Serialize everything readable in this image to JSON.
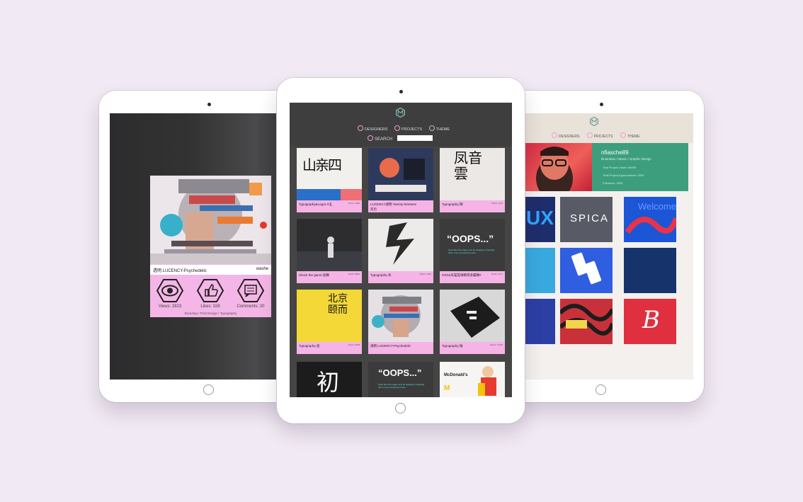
{
  "center": {
    "nav": {
      "items": [
        "DESIGNERS",
        "PROJECTS",
        "THEME"
      ],
      "search_label": "SEARCH"
    },
    "cards": [
      {
        "title": "Typography&Logos #五",
        "views": "Views: 1848",
        "art_text": "山亲四"
      },
      {
        "title": "LUCENCY透明 Twenty Nineteen",
        "title2": "年历",
        "views": "",
        "art_text": ""
      },
      {
        "title": "Typography-御",
        "views": "Views: 1211",
        "art_text": "凤音雲"
      },
      {
        "title": "Shock the game-劲舞",
        "views": "Views: 8662",
        "art_text": ""
      },
      {
        "title": "Typography-冰",
        "views": "Views: 1034",
        "art_text": ""
      },
      {
        "title": "#2018天猫篮球精英争霸赛#",
        "views": "Views: 4271",
        "art_text": "“OOPS...”"
      },
      {
        "title": "Typography-佰",
        "views": "Views: 6628",
        "art_text": "北京颐而"
      },
      {
        "title": "透明 LUCENCY-Psychedelic",
        "views": "",
        "art_text": ""
      },
      {
        "title": "Typography-陆",
        "views": "Views: 17346",
        "art_text": ""
      },
      {
        "title": "",
        "views": "",
        "art_text": "初"
      },
      {
        "title": "",
        "views": "",
        "art_text": "“OOPS...”"
      },
      {
        "title": "",
        "views": "",
        "art_text": "McDonald's"
      }
    ],
    "oops_sub": "looks like this image can't be displayed, hopefully this is only a temporary issue."
  },
  "left": {
    "title": "透明 LUCENCY-Psychedelic",
    "user": "washe",
    "stats": [
      {
        "label": "Views: 2823",
        "icon": "eye-icon"
      },
      {
        "label": "Likes: 328",
        "icon": "thumbs-up-icon"
      },
      {
        "label": "Comments: 20",
        "icon": "comment-icon"
      }
    ],
    "tags": "Branding / Print Design / Typography"
  },
  "right": {
    "nav": {
      "items": [
        "DESIGNERS",
        "PROJECTS",
        "THEME"
      ]
    },
    "profile": {
      "name": "nfiasche89",
      "role": "Illustration / Music / Graphic Design",
      "meta": [
        "Total Project Views: 99999",
        "Total Project Appreciations: 3000",
        "Followers: 3000"
      ]
    },
    "thumbs": [
      {
        "text": "UX"
      },
      {
        "text": "SPICA"
      },
      {
        "text": "Welcome"
      },
      {
        "text": ""
      },
      {
        "text": ""
      },
      {
        "text": ""
      },
      {
        "text": ""
      },
      {
        "text": ""
      },
      {
        "text": "B"
      }
    ]
  },
  "colors": {
    "background": "#f1e9f3",
    "accent_pink": "#f5b3e6",
    "profile_green": "#3d9e7e",
    "dark_screen": "#454545"
  }
}
